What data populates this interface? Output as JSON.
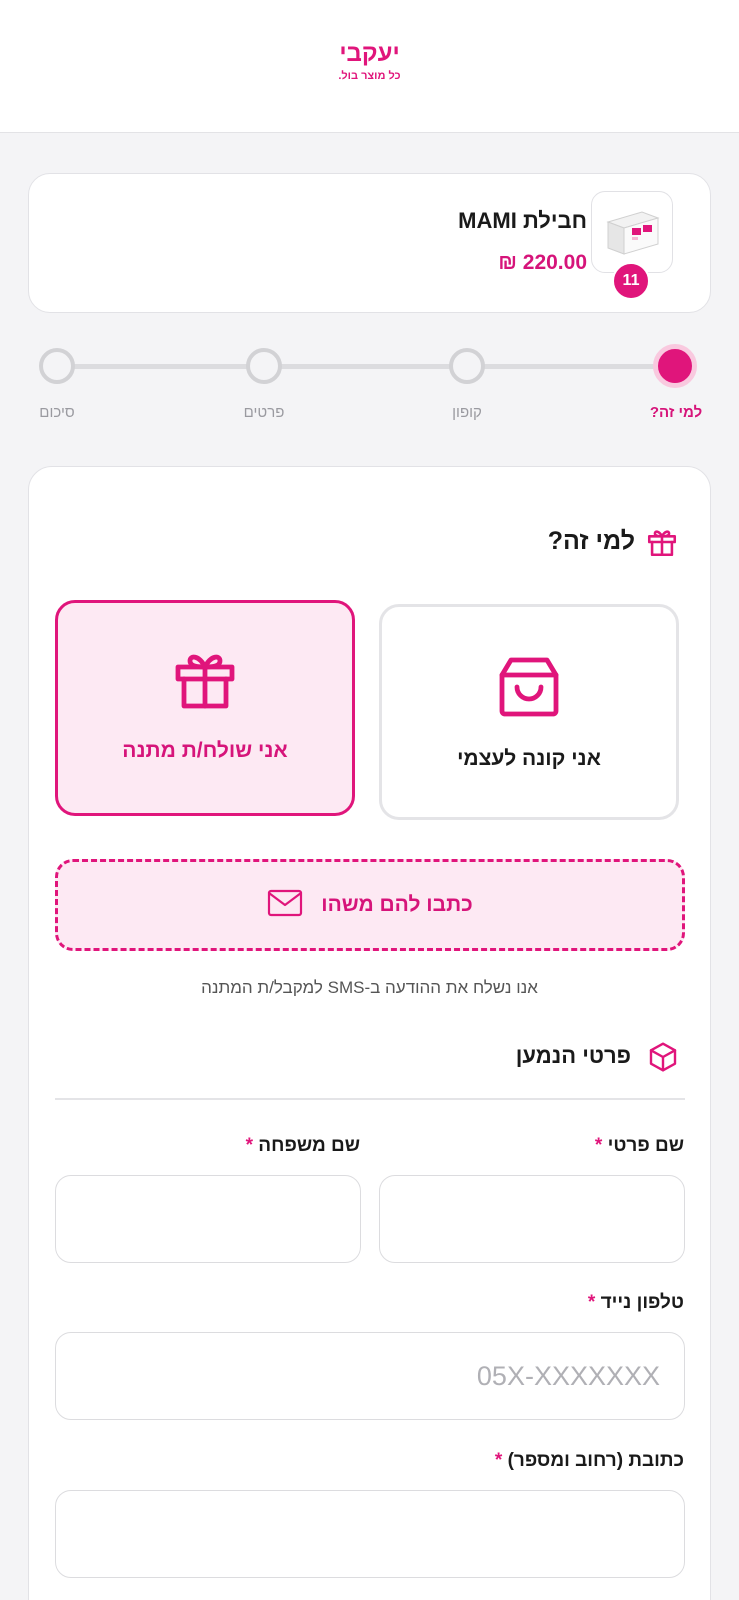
{
  "header": {
    "logo_text": "יעקבי",
    "logo_tagline": "כל מוצר בול."
  },
  "product": {
    "name": "חבילת MAMI",
    "price": "220.00 ₪",
    "quantity_badge": "11"
  },
  "stepper": {
    "steps": [
      {
        "label": "למי זה?",
        "active": true
      },
      {
        "label": "קופון",
        "active": false
      },
      {
        "label": "פרטים",
        "active": false
      },
      {
        "label": "סיכום",
        "active": false
      }
    ]
  },
  "who_section": {
    "title": "למי זה?",
    "option_self": "אני קונה לעצמי",
    "option_gift": "אני שולח/ת מתנה",
    "selected": "gift"
  },
  "message": {
    "button_label": "כתבו להם משהו",
    "sms_note": "אנו נשלח את ההודעה ב-SMS למקבל/ת המתנה"
  },
  "recipient_section": {
    "title": "פרטי הנמען",
    "first_name_label": "שם פרטי",
    "last_name_label": "שם משפחה",
    "phone_label": "טלפון נייד",
    "phone_placeholder": "05X-XXXXXXX",
    "address_label": "כתובת (רחוב ומספר)",
    "required_mark": "*",
    "first_name_value": "",
    "last_name_value": "",
    "phone_value": "",
    "address_value": ""
  },
  "colors": {
    "accent": "#e0157b",
    "accent_light": "#fde9f3",
    "background": "#f4f4f6"
  }
}
